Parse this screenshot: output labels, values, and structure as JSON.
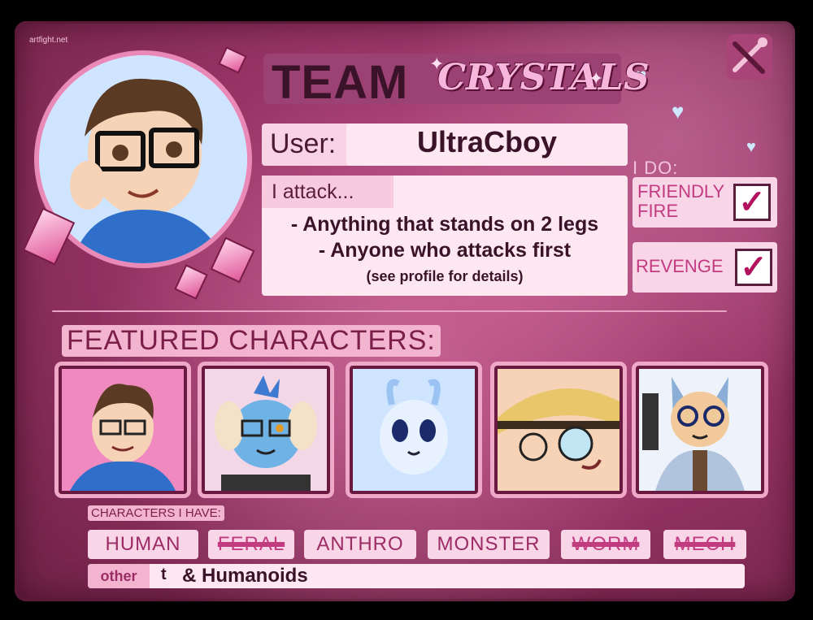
{
  "watermark": "artfight.net",
  "team": {
    "prefix": "TEAM",
    "name": "CRYSTALS"
  },
  "user": {
    "label": "User:",
    "name": "UltraCboy"
  },
  "attack": {
    "label": "I attack...",
    "lines": [
      "- Anything that stands on 2 legs",
      "- Anyone who attacks first",
      "(see profile for details)"
    ]
  },
  "ido": {
    "label": "I DO:",
    "options": [
      {
        "label_line1": "FRIENDLY",
        "label_line2": "FIRE",
        "checked_mark": "✓"
      },
      {
        "label_line1": "REVENGE",
        "label_line2": "",
        "checked_mark": "✓"
      }
    ]
  },
  "featured": {
    "label": "FEATURED CHARACTERS:"
  },
  "characters_have": {
    "label": "CHARACTERS I HAVE:",
    "tags": [
      {
        "label": "HUMAN",
        "struck": false
      },
      {
        "label": "FERAL",
        "struck": true
      },
      {
        "label": "ANTHRO",
        "struck": false
      },
      {
        "label": "MONSTER",
        "struck": false
      },
      {
        "label": "WORM",
        "struck": true
      },
      {
        "label": "MECH",
        "struck": true
      }
    ]
  },
  "other": {
    "label": "other",
    "icon": "tumblr-t-icon",
    "icon_glyph": "t",
    "text": "& Humanoids"
  },
  "colors": {
    "accent": "#c23b80",
    "card": "#9a3668",
    "dark_text": "#3a1328"
  }
}
